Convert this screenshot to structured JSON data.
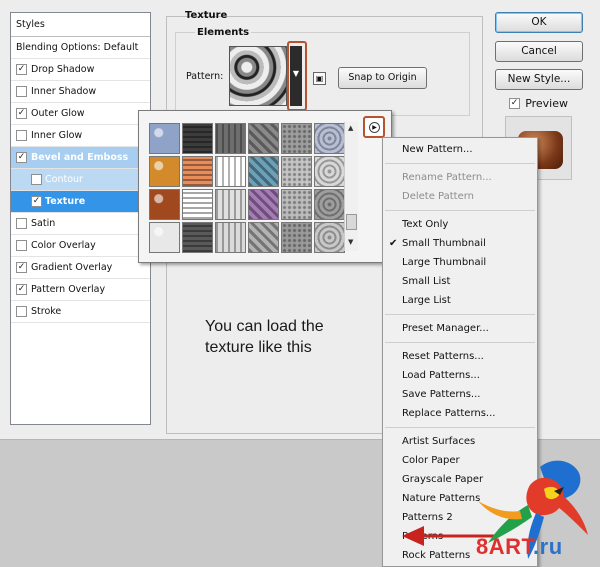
{
  "styles_panel": {
    "header": "Styles",
    "blending": "Blending Options: Default",
    "items": [
      {
        "label": "Drop Shadow",
        "checked": true
      },
      {
        "label": "Inner Shadow",
        "checked": false
      },
      {
        "label": "Outer Glow",
        "checked": true
      },
      {
        "label": "Inner Glow",
        "checked": false
      },
      {
        "label": "Bevel and Emboss",
        "checked": true
      },
      {
        "label": "Contour",
        "checked": false
      },
      {
        "label": "Texture",
        "checked": true
      },
      {
        "label": "Satin",
        "checked": false
      },
      {
        "label": "Color Overlay",
        "checked": false
      },
      {
        "label": "Gradient Overlay",
        "checked": true
      },
      {
        "label": "Pattern Overlay",
        "checked": true
      },
      {
        "label": "Stroke",
        "checked": false
      }
    ]
  },
  "texture_panel": {
    "title": "Texture",
    "elements_title": "Elements",
    "pattern_label": "Pattern:",
    "snap_button": "Snap to Origin"
  },
  "buttons": {
    "ok": "OK",
    "cancel": "Cancel",
    "new_style": "New Style...",
    "preview": "Preview"
  },
  "picker": {
    "tile_colors": [
      "#8fa3c8",
      "#3c3c3c",
      "#6e6e6e",
      "#8a8a8a",
      "#9d9d9d",
      "#b7bfd7",
      "#d28a2a",
      "#e88c5a",
      "#ffffff",
      "#6aa0b8",
      "#c4c4c4",
      "#d8d8d8",
      "#a0481e",
      "#ffffff",
      "#e0e0e0",
      "#a77ab8",
      "#bcbcbc",
      "#9e9e9e",
      "#e8e8e8",
      "#5a5a5a",
      "#dadada",
      "#b2b2b2",
      "#9a9a9a",
      "#c8c8c8"
    ]
  },
  "menu": {
    "groups": [
      [
        {
          "label": "New Pattern...",
          "disabled": false
        }
      ],
      [
        {
          "label": "Rename Pattern...",
          "disabled": true
        },
        {
          "label": "Delete Pattern",
          "disabled": true
        }
      ],
      [
        {
          "label": "Text Only"
        },
        {
          "label": "Small Thumbnail",
          "checked": true
        },
        {
          "label": "Large Thumbnail"
        },
        {
          "label": "Small List"
        },
        {
          "label": "Large List"
        }
      ],
      [
        {
          "label": "Preset Manager..."
        }
      ],
      [
        {
          "label": "Reset Patterns..."
        },
        {
          "label": "Load Patterns..."
        },
        {
          "label": "Save Patterns..."
        },
        {
          "label": "Replace Patterns..."
        }
      ],
      [
        {
          "label": "Artist Surfaces"
        },
        {
          "label": "Color Paper"
        },
        {
          "label": "Grayscale Paper"
        },
        {
          "label": "Nature Patterns"
        },
        {
          "label": "Patterns 2"
        },
        {
          "label": "Patterns"
        },
        {
          "label": "Rock Patterns"
        }
      ]
    ]
  },
  "annotation": "You can load the texture like this",
  "watermark": {
    "part_a": "8ART",
    "part_b": ".ru"
  },
  "colors": {
    "highlight": "#3394e8",
    "highlight_light": "#a7cdf0",
    "callout": "#b65430",
    "arrow": "#c8231f"
  }
}
